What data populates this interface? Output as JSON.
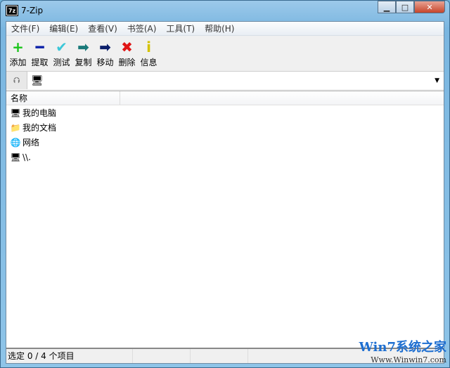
{
  "window": {
    "title": "7-Zip",
    "logo": "7z"
  },
  "menu": [
    "文件(F)",
    "编辑(E)",
    "查看(V)",
    "书签(A)",
    "工具(T)",
    "帮助(H)"
  ],
  "toolbar": [
    {
      "label": "添加",
      "icon": "+",
      "color": "#19c419"
    },
    {
      "label": "提取",
      "icon": "━",
      "color": "#0a1fa8"
    },
    {
      "label": "测试",
      "icon": "✔",
      "color": "#3cc7d8"
    },
    {
      "label": "复制",
      "icon": "➡",
      "color": "#1a7a7a"
    },
    {
      "label": "移动",
      "icon": "➡",
      "color": "#0c1f6b"
    },
    {
      "label": "删除",
      "icon": "✖",
      "color": "#e01515"
    },
    {
      "label": "信息",
      "icon": "i",
      "color": "#d4c200"
    }
  ],
  "list": {
    "header": "名称",
    "items": [
      {
        "name": "我的电脑",
        "icon": "computer-icon"
      },
      {
        "name": "我的文档",
        "icon": "documents-icon"
      },
      {
        "name": "网络",
        "icon": "network-icon"
      },
      {
        "name": "\\\\.",
        "icon": "computer-icon"
      }
    ]
  },
  "status": {
    "text": "选定 0 / 4 个项目"
  },
  "watermark": {
    "title": "Win7系统之家",
    "url": "Www.Winwin7.com"
  }
}
